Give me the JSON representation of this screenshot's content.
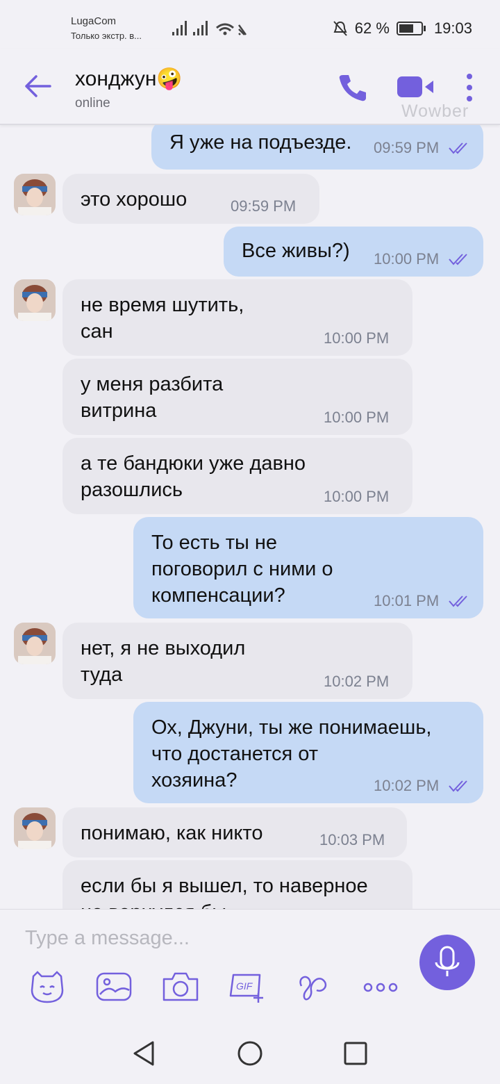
{
  "status_bar": {
    "carrier": "LugaCom",
    "carrier_sub": "Только экстр. в...",
    "battery": "62 %",
    "time": "19:03"
  },
  "header": {
    "contact_name": "хонджун🤪",
    "contact_status": "online",
    "watermark": "Wowber",
    "accent_color": "#7360dd"
  },
  "messages": [
    {
      "dir": "out",
      "text": "Я уже на подъезде.",
      "time": "09:59 PM"
    },
    {
      "dir": "in",
      "text": "это хорошо",
      "time": "09:59 PM"
    },
    {
      "dir": "out",
      "text": "Все живы?)",
      "time": "10:00 PM"
    },
    {
      "dir": "in",
      "text": "не время шутить,\nсан",
      "time": "10:00 PM"
    },
    {
      "dir": "in",
      "text": "у меня разбита\nвитрина",
      "time": "10:00 PM"
    },
    {
      "dir": "in",
      "text": "а те бандюки уже давно\nразошлись",
      "time": "10:00 PM"
    },
    {
      "dir": "out",
      "text": "То есть ты не\nпоговорил с ними о\nкомпенсации?",
      "time": "10:01 PM"
    },
    {
      "dir": "in",
      "text": "нет, я не выходил\nтуда",
      "time": "10:02 PM"
    },
    {
      "dir": "out",
      "text": "Ох, Джуни, ты же понимаешь,\nчто достанется от\nхозяина?",
      "time": "10:02 PM"
    },
    {
      "dir": "in",
      "text": "понимаю, как никто",
      "time": "10:03 PM"
    },
    {
      "dir": "in",
      "text": "если бы я вышел, то наверное\nне вернулся бы",
      "time": ""
    }
  ],
  "composer": {
    "placeholder": "Type a message..."
  },
  "toolbar_icons": [
    "sticker-icon",
    "image-icon",
    "camera-icon",
    "gif-icon",
    "doodle-icon",
    "more-options-icon"
  ]
}
